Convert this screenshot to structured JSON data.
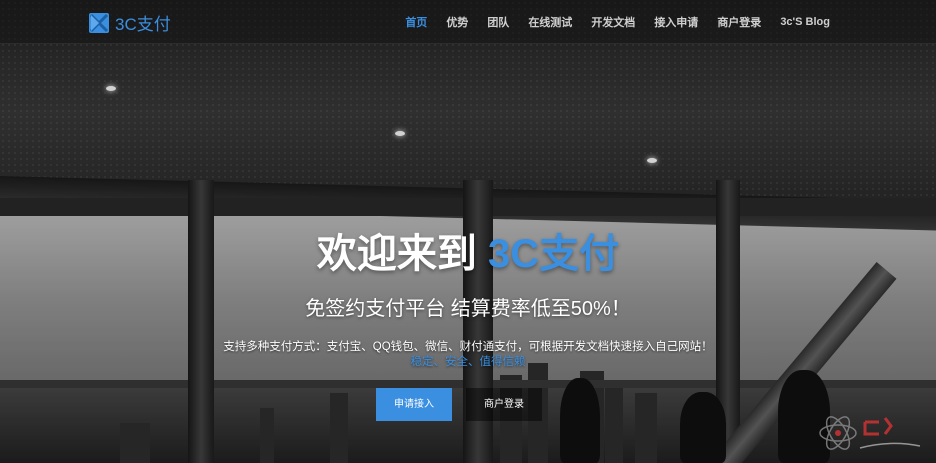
{
  "brand": {
    "name": "3C支付",
    "icon": "logo-icon",
    "color": "#3a8fe0"
  },
  "nav": {
    "items": [
      {
        "label": "首页",
        "active": true
      },
      {
        "label": "优势",
        "active": false
      },
      {
        "label": "团队",
        "active": false
      },
      {
        "label": "在线测试",
        "active": false
      },
      {
        "label": "开发文档",
        "active": false
      },
      {
        "label": "接入申请",
        "active": false
      },
      {
        "label": "商户登录",
        "active": false
      },
      {
        "label": "3c'S Blog",
        "active": false
      }
    ]
  },
  "hero": {
    "title_prefix": "欢迎来到",
    "title_accent": "3C支付",
    "subtitle": "免签约支付平台 结算费率低至50%！",
    "description": "支持多种支付方式：支付宝、QQ钱包、微信、财付通支付，可根据开发文档快速接入自己网站！",
    "tags": "稳定、安全、值得信赖",
    "apply_button": "申请接入",
    "login_button": "商户登录"
  },
  "colors": {
    "accent": "#3a8fe0",
    "nav_text": "#cfcfcf",
    "text": "#ffffff"
  }
}
